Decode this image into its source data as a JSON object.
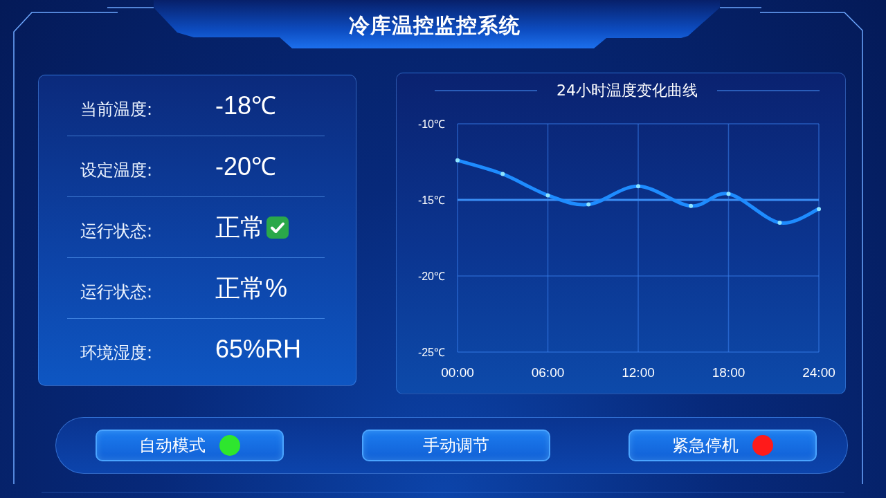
{
  "header": {
    "title": "冷库温控监控系统"
  },
  "status_panel": {
    "rows": [
      {
        "kind": "text",
        "label": "当前温度:",
        "value": "-18℃"
      },
      {
        "kind": "text",
        "label": "设定温度:",
        "value": "-20℃"
      },
      {
        "kind": "status",
        "label": "运行状态:",
        "value": "正常"
      },
      {
        "kind": "text",
        "label": "运行状态:",
        "value": "正常%"
      },
      {
        "kind": "text",
        "label": "环境湿度:",
        "value": "65%RH"
      }
    ]
  },
  "chart_panel": {
    "chart_data": {
      "type": "line",
      "title": "24小时温度变化曲线",
      "x": [
        0,
        3,
        6,
        8.7,
        12,
        15.5,
        18,
        21.4,
        24
      ],
      "series": [
        {
          "color": "#1e8cff",
          "marker": "circle",
          "values": [
            -12.4,
            -13.3,
            -14.7,
            -15.3,
            -14.1,
            -15.4,
            -14.6,
            -16.5,
            -15.6
          ]
        }
      ],
      "xlim": [
        0,
        24
      ],
      "ylim": [
        -25,
        -10
      ],
      "xticks": [
        {
          "value": 0,
          "label": "00:00"
        },
        {
          "value": 6,
          "label": "06:00"
        },
        {
          "value": 12,
          "label": "12:00"
        },
        {
          "value": 18,
          "label": "18:00"
        },
        {
          "value": 24,
          "label": "24:00"
        }
      ],
      "yticks": [
        {
          "value": -10,
          "label": "-10℃"
        },
        {
          "value": -15,
          "label": "-15℃"
        },
        {
          "value": -20,
          "label": "-20℃"
        },
        {
          "value": -25,
          "label": "-25℃"
        }
      ],
      "grid": true,
      "ref_lines": [
        {
          "axis": "y",
          "value": -15
        }
      ]
    }
  },
  "control_bar": {
    "buttons": [
      {
        "label": "自动模式",
        "color": "#2ee62e"
      },
      {
        "label": "手动调节"
      },
      {
        "label": "紧急停机",
        "color": "#ff1a1a"
      }
    ]
  }
}
